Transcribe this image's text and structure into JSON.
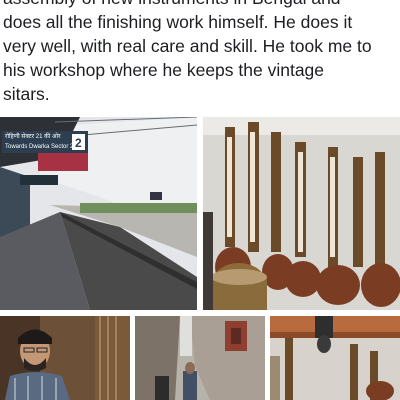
{
  "post": {
    "text": "assembly of new instruments in Bengal and\ndoes all the finishing work himself. He does it\nvery well, with real care and skill. He took me to\nhis workshop where he keeps the vintage\nsitars."
  },
  "photos": [
    {
      "name": "photo-metro-platform",
      "sign_top_line": "रोहिणी सेक्टर 21 की ओर",
      "sign_main": "Towards Dwarka Sector 21",
      "sign_number": "2"
    },
    {
      "name": "photo-sitars-wall"
    },
    {
      "name": "photo-craftsman"
    },
    {
      "name": "photo-narrow-lane"
    },
    {
      "name": "photo-workshop-ceiling"
    }
  ],
  "colors": {
    "text": "#1c1e21",
    "background": "#ffffff"
  }
}
